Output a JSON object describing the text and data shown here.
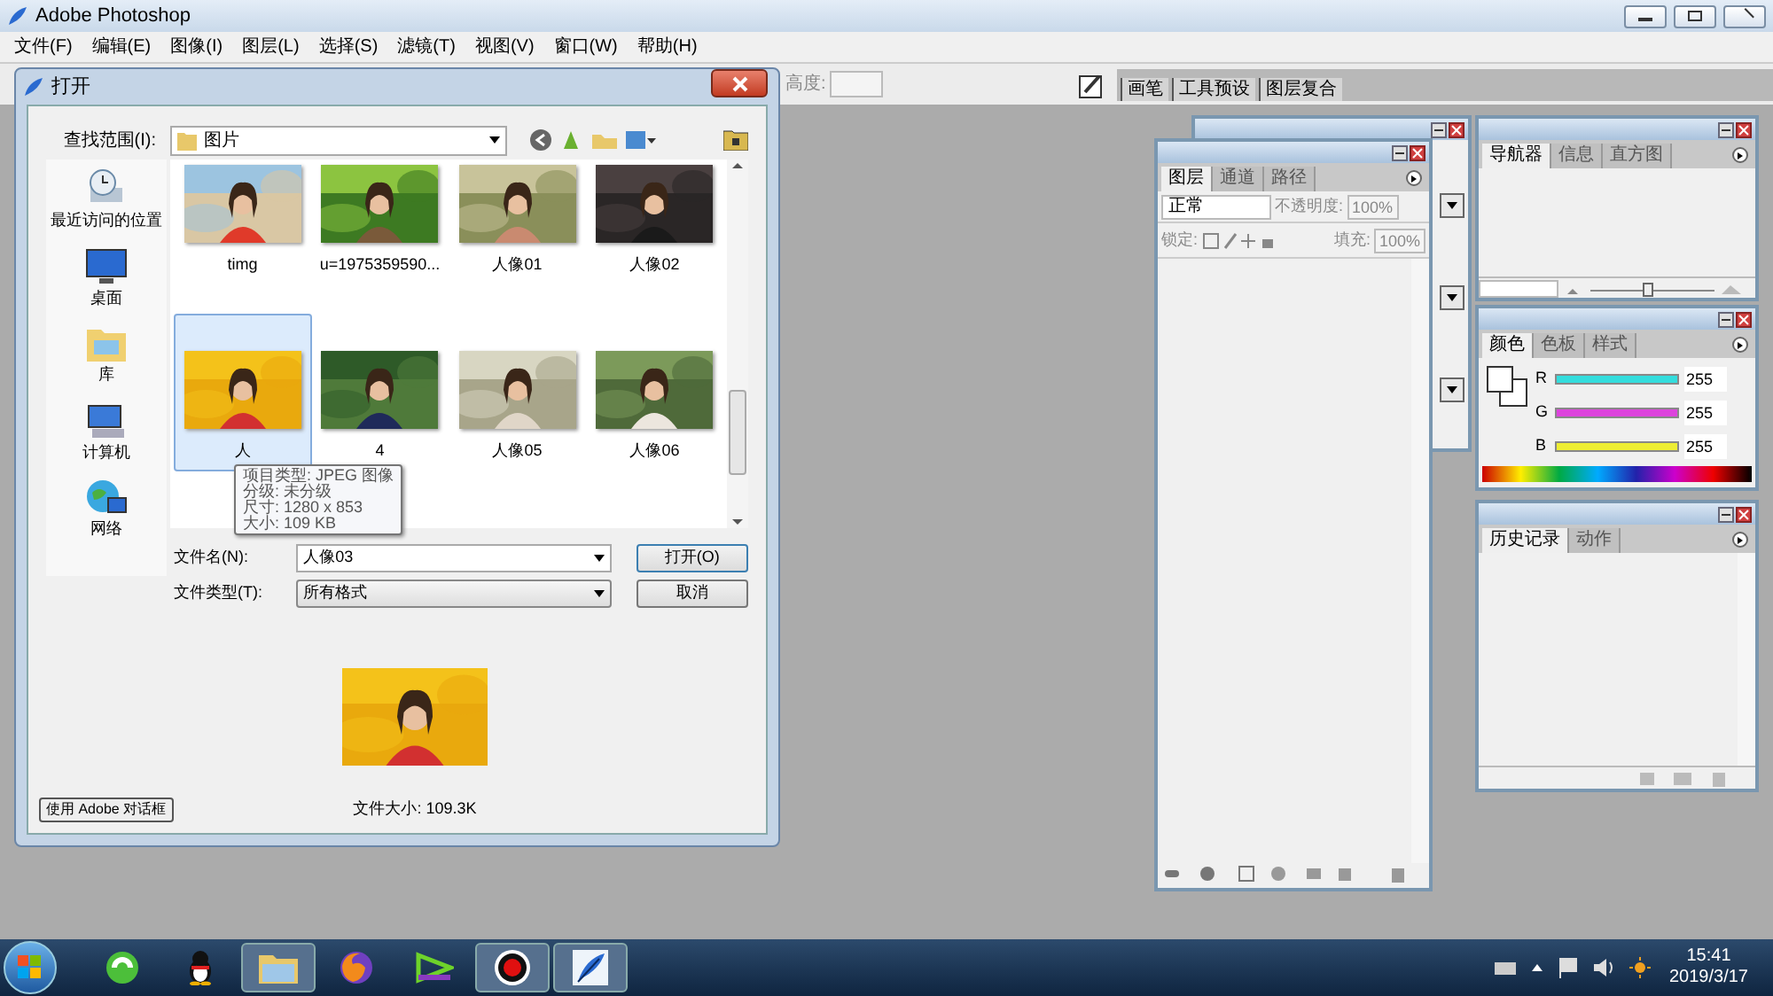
{
  "window": {
    "title": "Adobe Photoshop"
  },
  "menu": [
    "文件(F)",
    "编辑(E)",
    "图像(I)",
    "图层(L)",
    "选择(S)",
    "滤镜(T)",
    "视图(V)",
    "窗口(W)",
    "帮助(H)"
  ],
  "options_bar": {
    "height_label": "高度:",
    "palette_tabs": [
      "画笔",
      "工具预设",
      "图层复合"
    ]
  },
  "open_dialog": {
    "title": "打开",
    "look_in_label": "查找范围(I):",
    "look_in_value": "图片",
    "places": [
      {
        "label": "最近访问的位置",
        "kind": "recent"
      },
      {
        "label": "桌面",
        "kind": "desktop"
      },
      {
        "label": "库",
        "kind": "library"
      },
      {
        "label": "计算机",
        "kind": "computer"
      },
      {
        "label": "网络",
        "kind": "network"
      }
    ],
    "files": [
      {
        "name": "timg",
        "kind": "beach",
        "selected": false
      },
      {
        "name": "u=1975359590...",
        "kind": "road",
        "selected": false
      },
      {
        "name": "人像01",
        "kind": "portrait",
        "selected": false
      },
      {
        "name": "人像02",
        "kind": "dark",
        "selected": false
      },
      {
        "name": "人",
        "kind": "yellow",
        "selected": true
      },
      {
        "name": "4",
        "kind": "park",
        "selected": false
      },
      {
        "name": "人像05",
        "kind": "field",
        "selected": false
      },
      {
        "name": "人像06",
        "kind": "garden",
        "selected": false
      }
    ],
    "tooltip": [
      "项目类型: JPEG 图像",
      "分级: 未分级",
      "尺寸: 1280 x 853",
      "大小: 109 KB"
    ],
    "file_name_label": "文件名(N):",
    "file_name_value": "人像03",
    "file_type_label": "文件类型(T):",
    "file_type_value": "所有格式",
    "open_button": "打开(O)",
    "cancel_button": "取消",
    "file_size": "文件大小: 109.3K",
    "adobe_dialog_button": "使用 Adobe 对话框"
  },
  "layers_panel": {
    "tabs": [
      {
        "label": "图层",
        "selected": true
      },
      {
        "label": "通道",
        "selected": false
      },
      {
        "label": "路径",
        "selected": false
      }
    ],
    "blend_mode": "正常",
    "opacity_label": "不透明度:",
    "opacity": "100%",
    "lock_label": "锁定:",
    "fill_label": "填充:",
    "fill": "100%"
  },
  "navigator_panel": {
    "tabs": [
      {
        "label": "导航器",
        "selected": true
      },
      {
        "label": "信息",
        "selected": false
      },
      {
        "label": "直方图",
        "selected": false
      }
    ]
  },
  "color_panel": {
    "tabs": [
      {
        "label": "颜色",
        "selected": true
      },
      {
        "label": "色板",
        "selected": false
      },
      {
        "label": "样式",
        "selected": false
      }
    ],
    "channels": [
      {
        "name": "R",
        "value": "255",
        "level": 1,
        "color": "#33dddd"
      },
      {
        "name": "G",
        "value": "255",
        "level": 1,
        "color": "#dd44dd"
      },
      {
        "name": "B",
        "value": "255",
        "level": 1,
        "color": "#eeee33"
      }
    ]
  },
  "history_panel": {
    "tabs": [
      {
        "label": "历史记录",
        "selected": true
      },
      {
        "label": "动作",
        "selected": false
      }
    ]
  },
  "taskbar": {
    "apps": [
      {
        "kind": "browser",
        "selected": false
      },
      {
        "kind": "penguin",
        "selected": false
      },
      {
        "kind": "folder",
        "selected": true
      },
      {
        "kind": "firefox",
        "selected": false
      },
      {
        "kind": "player",
        "selected": false
      },
      {
        "kind": "recorder",
        "selected": true
      },
      {
        "kind": "feather",
        "selected": true
      }
    ],
    "time": "15:41",
    "date": "2019/3/17"
  }
}
